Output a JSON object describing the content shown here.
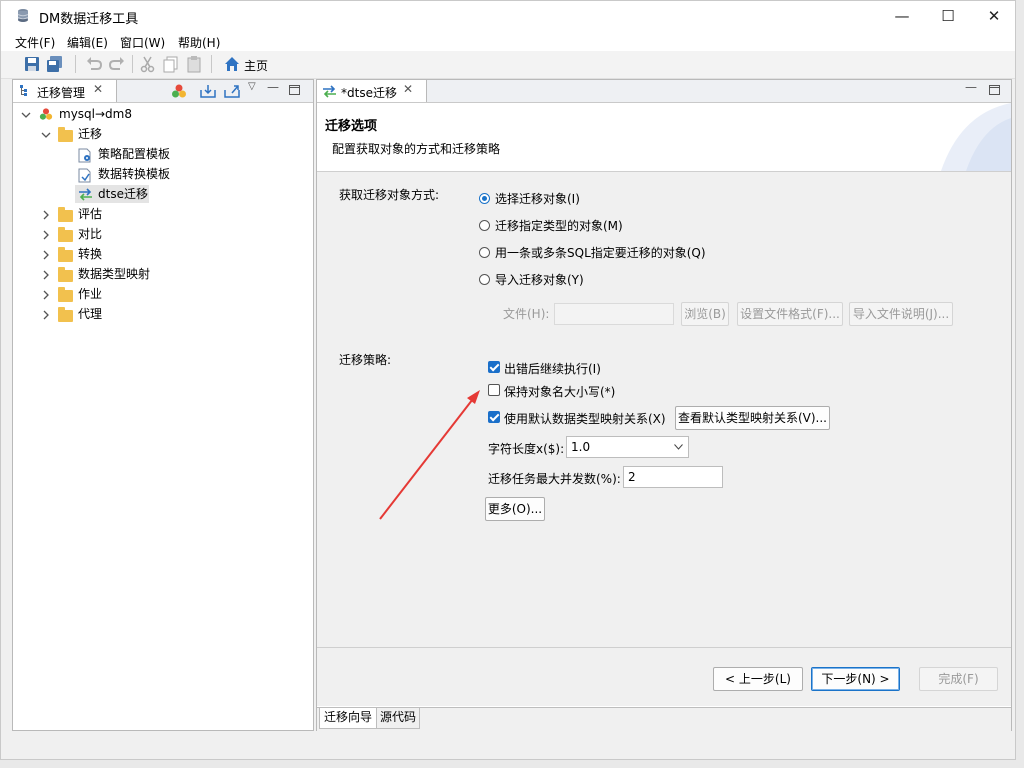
{
  "window": {
    "title": "DM数据迁移工具",
    "minimize": "—",
    "maximize": "☐",
    "close": "✕"
  },
  "menu": [
    "文件(F)",
    "编辑(E)",
    "窗口(W)",
    "帮助(H)"
  ],
  "toolbar": {
    "home_label": "主页"
  },
  "left_panel": {
    "tab_label": "迁移管理",
    "tree": {
      "root": "mysql→dm8",
      "migration_folder": "迁移",
      "migration_children": [
        "策略配置模板",
        "数据转换模板",
        "dtse迁移"
      ],
      "other_folders": [
        "评估",
        "对比",
        "转换",
        "数据类型映射",
        "作业",
        "代理"
      ]
    }
  },
  "editor": {
    "tab_label": "*dtse迁移",
    "header_title": "迁移选项",
    "header_desc": "配置获取对象的方式和迁移策略",
    "acquire_label": "获取迁移对象方式:",
    "radio_options": [
      "选择迁移对象(I)",
      "迁移指定类型的对象(M)",
      "用一条或多条SQL指定要迁移的对象(Q)",
      "导入迁移对象(Y)"
    ],
    "selected_radio": "选择迁移对象(I)",
    "file_label": "文件(H):",
    "file_value": "",
    "browse_btn": "浏览(B)",
    "file_format_btn": "设置文件格式(F)...",
    "import_desc_btn": "导入文件说明(J)...",
    "strategy_label": "迁移策略:",
    "chk_continue": "出错后继续执行(I)",
    "chk_keep_case": "保持对象名大小写(*)",
    "chk_default_map": "使用默认数据类型映射关系(X)",
    "view_map_btn": "查看默认类型映射关系(V)...",
    "char_len_label": "字符长度x($):",
    "char_len_value": "1.0",
    "max_concurrency_label": "迁移任务最大并发数(%):",
    "max_concurrency_value": "2",
    "more_btn": "更多(O)...",
    "prev_btn": "< 上一步(L)",
    "next_btn": "下一步(N) >",
    "finish_btn": "完成(F)",
    "bottom_tabs": [
      "迁移向导",
      "源代码"
    ]
  },
  "colors": {
    "accent": "#1a73c9",
    "annotation_arrow": "#e53935",
    "folder": "#f2c14e"
  }
}
